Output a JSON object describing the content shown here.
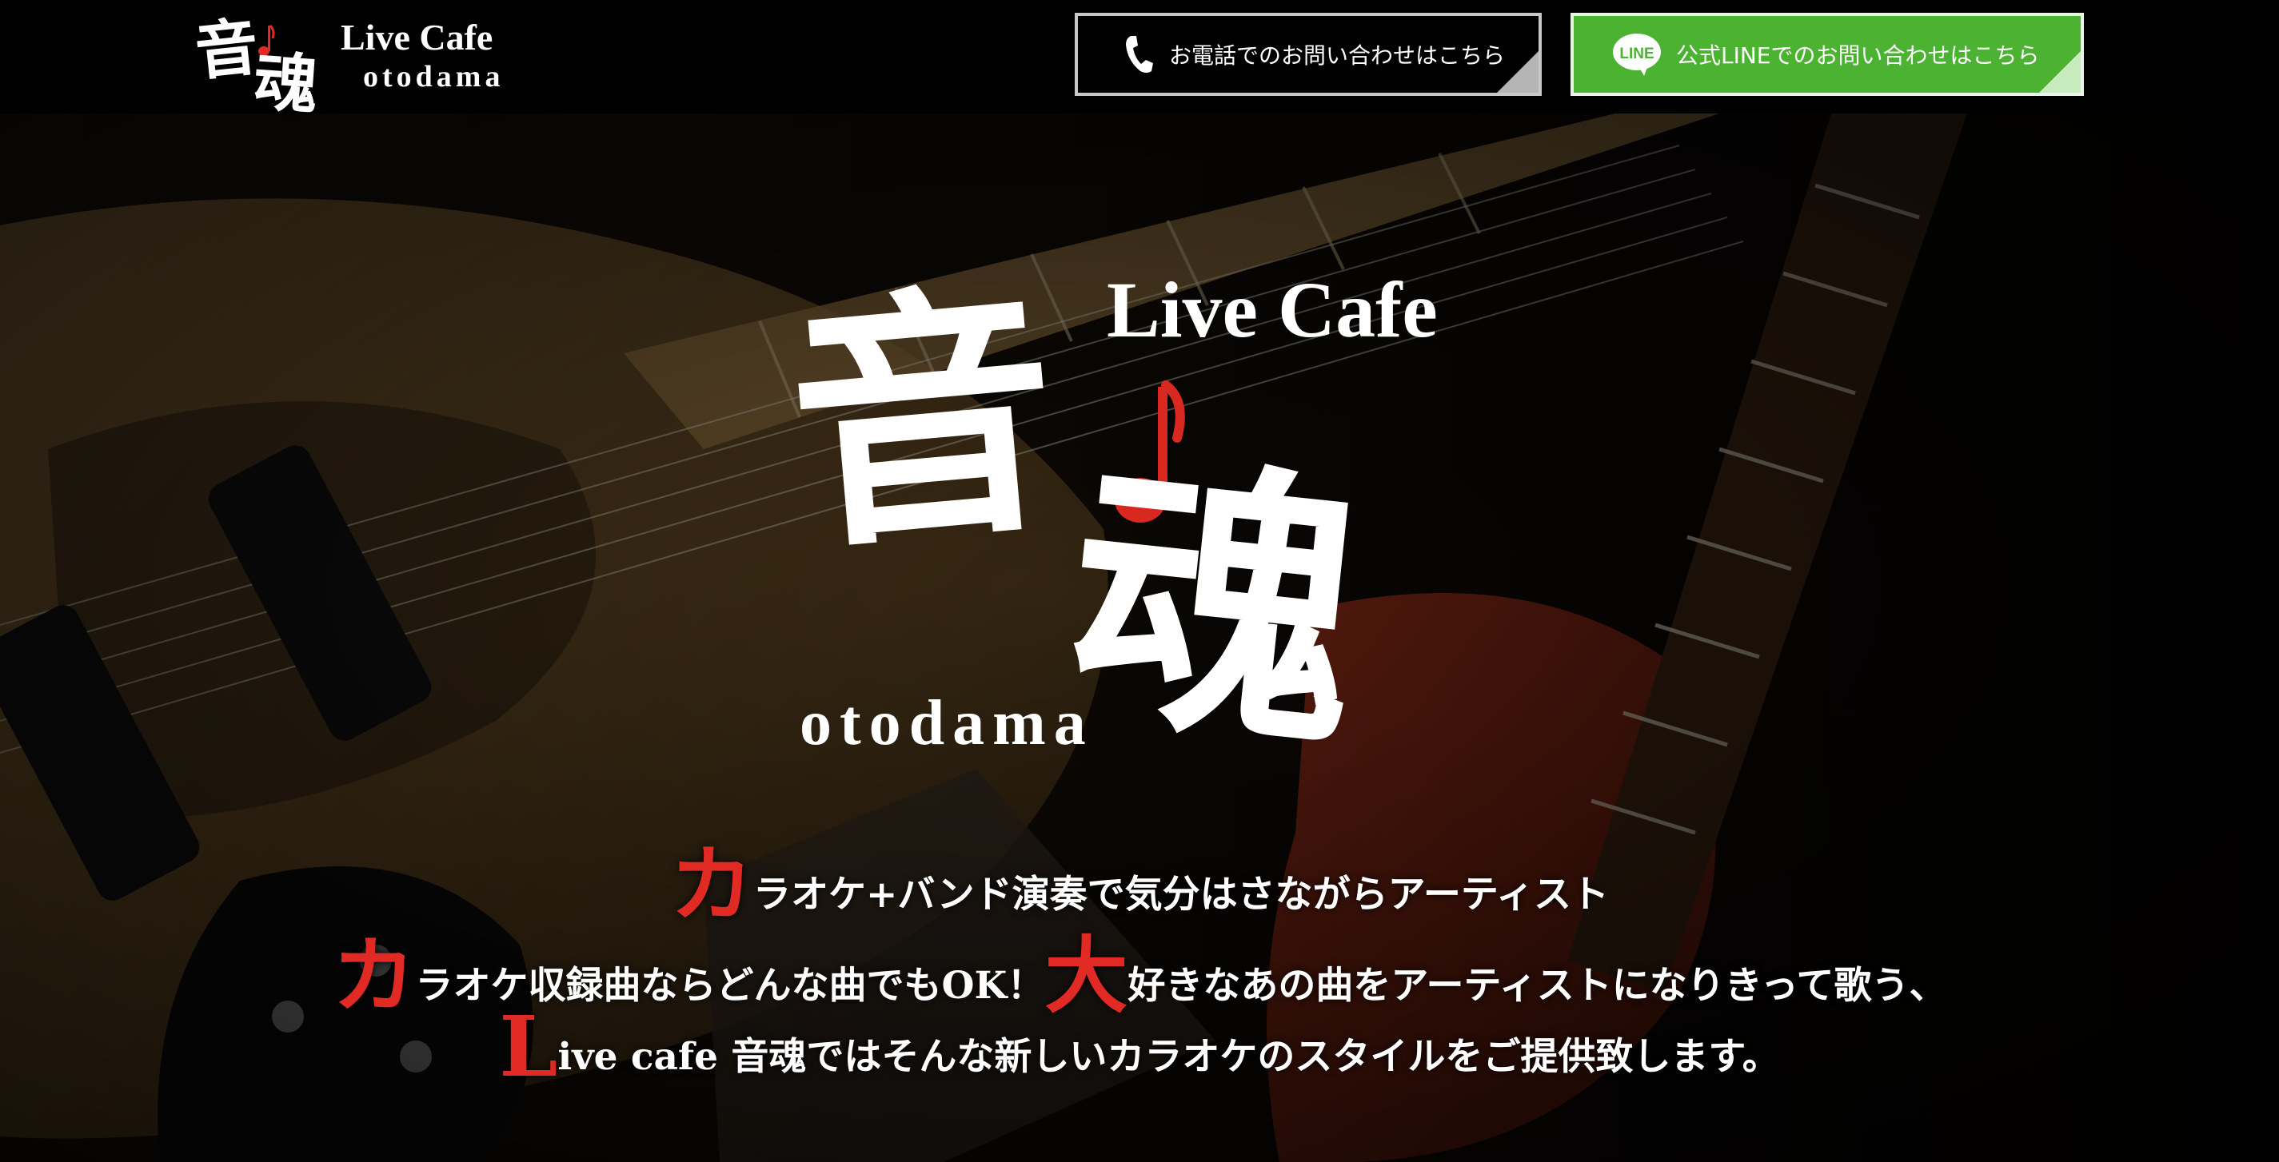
{
  "header": {
    "logo": {
      "kanji_1": "音",
      "kanji_2": "魂",
      "live_cafe": "Live Cafe",
      "otodama": "otodama"
    },
    "phone_button": {
      "label": "お電話でのお問い合わせはこちら",
      "icon": "phone-icon"
    },
    "line_button": {
      "label": "公式LINEでのお問い合わせはこちら",
      "icon": "line-icon",
      "icon_text": "LINE"
    }
  },
  "hero": {
    "logo": {
      "live_cafe": "Live Cafe",
      "kanji_1": "音",
      "kanji_2": "魂",
      "otodama": "otodama"
    },
    "tagline": [
      {
        "initial": "カ",
        "text": "ラオケ+バンド演奏で気分はさながらアーティスト"
      },
      {
        "initial": "カ",
        "text": "ラオケ収録曲ならどんな曲でもOK！",
        "initial_2": "大",
        "text_2": "好きなあの曲をアーティストになりきって歌う、"
      },
      {
        "initial": "L",
        "text": "ive cafe 音魂ではそんな新しいカラオケのスタイルをご提供致します。"
      }
    ]
  },
  "colors": {
    "background": "#000000",
    "line_green": "#4cb232",
    "accent_red": "#e12a24",
    "button_border_gray": "#c8c8c8"
  }
}
